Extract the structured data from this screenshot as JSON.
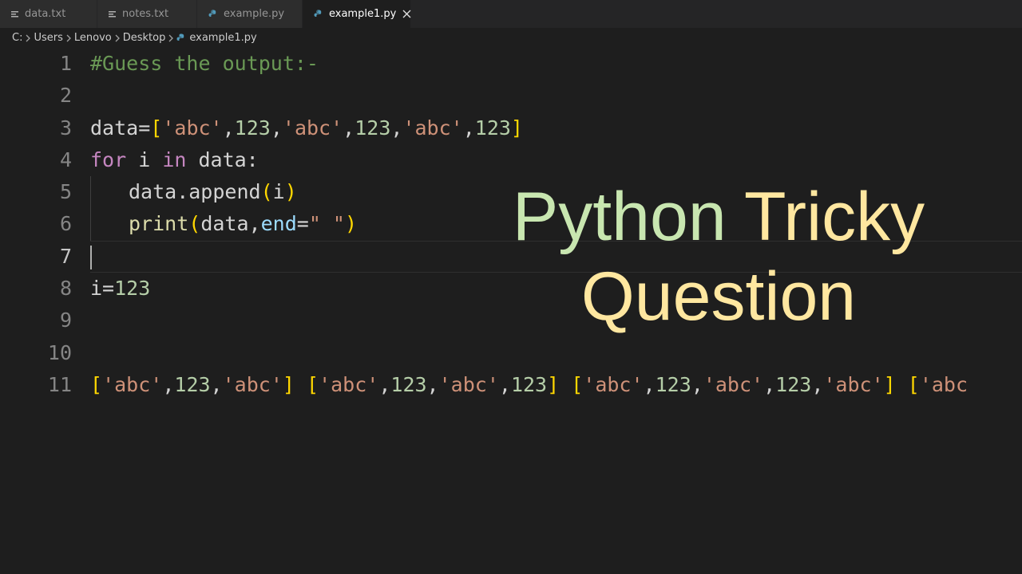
{
  "tabs": [
    {
      "label": "data.txt",
      "icon": "text-file-icon",
      "active": false
    },
    {
      "label": "notes.txt",
      "icon": "text-file-icon",
      "active": false
    },
    {
      "label": "example.py",
      "icon": "python-file-icon",
      "active": false
    },
    {
      "label": "example1.py",
      "icon": "python-file-icon",
      "active": true
    }
  ],
  "breadcrumb": [
    "C:",
    "Users",
    "Lenovo",
    "Desktop",
    "example1.py"
  ],
  "line_numbers": [
    "1",
    "2",
    "3",
    "4",
    "5",
    "6",
    "7",
    "8",
    "9",
    "10",
    "11"
  ],
  "current_line": 7,
  "code": {
    "l1": "#Guess the output:-",
    "l3": {
      "a": "data",
      "b": "=",
      "c": "[",
      "d": "'abc'",
      "e": ",",
      "f": "123",
      "g": ",",
      "h": "'abc'",
      "i": ",",
      "j": "123",
      "k": ",",
      "l": "'abc'",
      "m": ",",
      "n": "123",
      "o": "]"
    },
    "l4": {
      "a": "for",
      "b": " i ",
      "c": "in",
      "d": " data:"
    },
    "l5": {
      "a": "data.append",
      "b": "(",
      "c": "i",
      "d": ")"
    },
    "l6": {
      "a": "print",
      "b": "(",
      "c": "data,",
      "d": "end",
      "e": "=",
      "f": "\" \"",
      "g": ")"
    },
    "l8": {
      "a": "i=",
      "b": "123"
    },
    "l11": [
      {
        "t": "[",
        "k": "br"
      },
      {
        "t": "'abc'",
        "k": "str"
      },
      {
        "t": ",",
        "k": "var"
      },
      {
        "t": "123",
        "k": "num"
      },
      {
        "t": ",",
        "k": "var"
      },
      {
        "t": "'abc'",
        "k": "str"
      },
      {
        "t": "]",
        "k": "br"
      },
      {
        "t": " ",
        "k": "var"
      },
      {
        "t": "[",
        "k": "br"
      },
      {
        "t": "'abc'",
        "k": "str"
      },
      {
        "t": ",",
        "k": "var"
      },
      {
        "t": "123",
        "k": "num"
      },
      {
        "t": ",",
        "k": "var"
      },
      {
        "t": "'abc'",
        "k": "str"
      },
      {
        "t": ",",
        "k": "var"
      },
      {
        "t": "123",
        "k": "num"
      },
      {
        "t": "]",
        "k": "br"
      },
      {
        "t": " ",
        "k": "var"
      },
      {
        "t": "[",
        "k": "br"
      },
      {
        "t": "'abc'",
        "k": "str"
      },
      {
        "t": ",",
        "k": "var"
      },
      {
        "t": "123",
        "k": "num"
      },
      {
        "t": ",",
        "k": "var"
      },
      {
        "t": "'abc'",
        "k": "str"
      },
      {
        "t": ",",
        "k": "var"
      },
      {
        "t": "123",
        "k": "num"
      },
      {
        "t": ",",
        "k": "var"
      },
      {
        "t": "'abc'",
        "k": "str"
      },
      {
        "t": "]",
        "k": "br"
      },
      {
        "t": " ",
        "k": "var"
      },
      {
        "t": "['abc",
        "k": "mixed"
      }
    ]
  },
  "overlay": {
    "line1": "Python Tricky",
    "line2": "Question"
  },
  "colors": {
    "comment": "#6a9955",
    "string": "#ce9178",
    "number": "#b5cea8",
    "keyword": "#c586c0",
    "bracket": "#ffd700",
    "param": "#9cdcfe",
    "overlay_green": "#c8e6b0",
    "overlay_yellow": "#ffe7a0"
  }
}
